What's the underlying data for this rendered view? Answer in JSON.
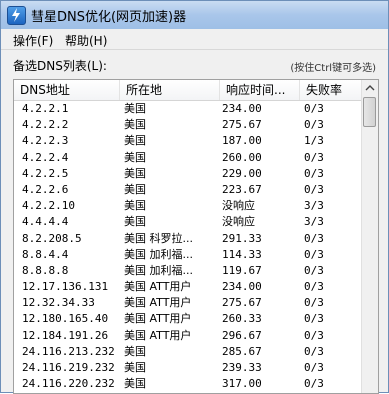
{
  "window": {
    "title": "彗星DNS优化(网页加速)器"
  },
  "menu": [
    "操作(F)",
    "帮助(H)"
  ],
  "list_label": "备选DNS列表(L):",
  "hint": "(按住Ctrl键可多选)",
  "columns": [
    "DNS地址",
    "所在地",
    "响应时间...",
    "失败率"
  ],
  "rows": [
    {
      "ip": "4.2.2.1",
      "loc": "美国",
      "time": "234.00",
      "fail": "0/3"
    },
    {
      "ip": "4.2.2.2",
      "loc": "美国",
      "time": "275.67",
      "fail": "0/3"
    },
    {
      "ip": "4.2.2.3",
      "loc": "美国",
      "time": "187.00",
      "fail": "1/3"
    },
    {
      "ip": "4.2.2.4",
      "loc": "美国",
      "time": "260.00",
      "fail": "0/3"
    },
    {
      "ip": "4.2.2.5",
      "loc": "美国",
      "time": "229.00",
      "fail": "0/3"
    },
    {
      "ip": "4.2.2.6",
      "loc": "美国",
      "time": "223.67",
      "fail": "0/3"
    },
    {
      "ip": "4.2.2.10",
      "loc": "美国",
      "time": "没响应",
      "fail": "3/3"
    },
    {
      "ip": "4.4.4.4",
      "loc": "美国",
      "time": "没响应",
      "fail": "3/3"
    },
    {
      "ip": "8.2.208.5",
      "loc": "美国 科罗拉...",
      "time": "291.33",
      "fail": "0/3"
    },
    {
      "ip": "8.8.4.4",
      "loc": "美国 加利福...",
      "time": "114.33",
      "fail": "0/3"
    },
    {
      "ip": "8.8.8.8",
      "loc": "美国 加利福...",
      "time": "119.67",
      "fail": "0/3"
    },
    {
      "ip": "12.17.136.131",
      "loc": "美国 ATT用户",
      "time": "234.00",
      "fail": "0/3"
    },
    {
      "ip": "12.32.34.33",
      "loc": "美国 ATT用户",
      "time": "275.67",
      "fail": "0/3"
    },
    {
      "ip": "12.180.165.40",
      "loc": "美国 ATT用户",
      "time": "260.33",
      "fail": "0/3"
    },
    {
      "ip": "12.184.191.26",
      "loc": "美国 ATT用户",
      "time": "296.67",
      "fail": "0/3"
    },
    {
      "ip": "24.116.213.232",
      "loc": "美国",
      "time": "285.67",
      "fail": "0/3"
    },
    {
      "ip": "24.116.219.232",
      "loc": "美国",
      "time": "239.33",
      "fail": "0/3"
    },
    {
      "ip": "24.116.220.232",
      "loc": "美国",
      "time": "317.00",
      "fail": "0/3"
    }
  ]
}
